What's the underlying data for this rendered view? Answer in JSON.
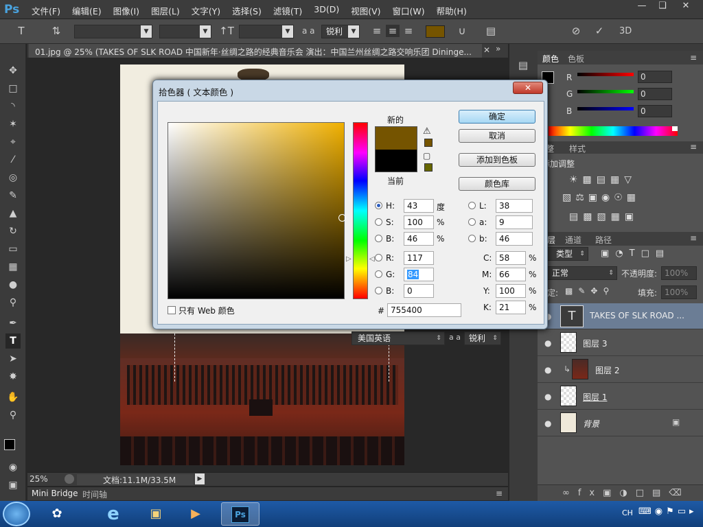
{
  "menubar": {
    "logo": "Ps",
    "menus": [
      "文件(F)",
      "编辑(E)",
      "图像(I)",
      "图层(L)",
      "文字(Y)",
      "选择(S)",
      "滤镜(T)",
      "3D(D)",
      "视图(V)",
      "窗口(W)",
      "帮助(H)"
    ],
    "window_controls": [
      "minimize-icon",
      "restore-icon",
      "close-icon"
    ]
  },
  "options_bar": {
    "size_unit_label": "a a",
    "antialias": "锐利",
    "swatch_color": "#755400",
    "label_3d": "3D"
  },
  "document": {
    "tab_title": "01.jpg @ 25% (TAKES  OF  SLK  ROAD 中国新年·丝绸之路的经典音乐会 演出：中国兰州丝绸之路交响乐团 Dininge...",
    "zoom": "25%",
    "doc_size": "文档:11.1M/33.5M"
  },
  "bottom_tabs": [
    "Mini Bridge",
    "时间轴"
  ],
  "color_panel": {
    "tabs": [
      "颜色",
      "色板"
    ],
    "channels": [
      {
        "label": "R",
        "value": "0"
      },
      {
        "label": "G",
        "value": "0"
      },
      {
        "label": "B",
        "value": "0"
      }
    ]
  },
  "adjust_panel": {
    "tabs": [
      "整",
      "样式"
    ],
    "subtitle": "添加调整"
  },
  "layers_panel": {
    "tabs": [
      "层",
      "通道",
      "路径"
    ],
    "filter": "类型",
    "blend_mode": "正常",
    "opacity_label": "不透明度:",
    "opacity": "100%",
    "lock_label": "定:",
    "fill_label": "填充:",
    "fill": "100%",
    "layers": [
      {
        "name": "TAKES  OF  SLK  ROAD ...",
        "kind": "text"
      },
      {
        "name": "图层 3",
        "kind": "empty"
      },
      {
        "name": "图层 2",
        "kind": "photo"
      },
      {
        "name": "图层 1",
        "kind": "empty"
      },
      {
        "name": "背景",
        "kind": "bg"
      }
    ]
  },
  "char_strip": {
    "language": "美国英语",
    "aa_label": "a a",
    "antialias": "锐利"
  },
  "color_picker": {
    "title": "拾色器 ( 文本颜色 )",
    "new_label": "新的",
    "current_label": "当前",
    "new_color": "#755400",
    "current_color": "#000000",
    "buttons": {
      "ok": "确定",
      "cancel": "取消",
      "add_swatch": "添加到色板",
      "color_libraries": "颜色库"
    },
    "hsb": [
      {
        "label": "H:",
        "value": "43",
        "unit": "度",
        "selected": true
      },
      {
        "label": "S:",
        "value": "100",
        "unit": "%"
      },
      {
        "label": "B:",
        "value": "46",
        "unit": "%"
      }
    ],
    "rgb": [
      {
        "label": "R:",
        "value": "117"
      },
      {
        "label": "G:",
        "value": "84"
      },
      {
        "label": "B:",
        "value": "0"
      }
    ],
    "lab": [
      {
        "label": "L:",
        "value": "38"
      },
      {
        "label": "a:",
        "value": "9"
      },
      {
        "label": "b:",
        "value": "46"
      }
    ],
    "cmyk": [
      {
        "label": "C:",
        "value": "58",
        "unit": "%"
      },
      {
        "label": "M:",
        "value": "66",
        "unit": "%"
      },
      {
        "label": "Y:",
        "value": "100",
        "unit": "%"
      },
      {
        "label": "K:",
        "value": "21",
        "unit": "%"
      }
    ],
    "hex_label": "#",
    "hex": "755400",
    "web_only_label": "只有 Web 颜色"
  },
  "taskbar": {
    "lang": "CH"
  }
}
